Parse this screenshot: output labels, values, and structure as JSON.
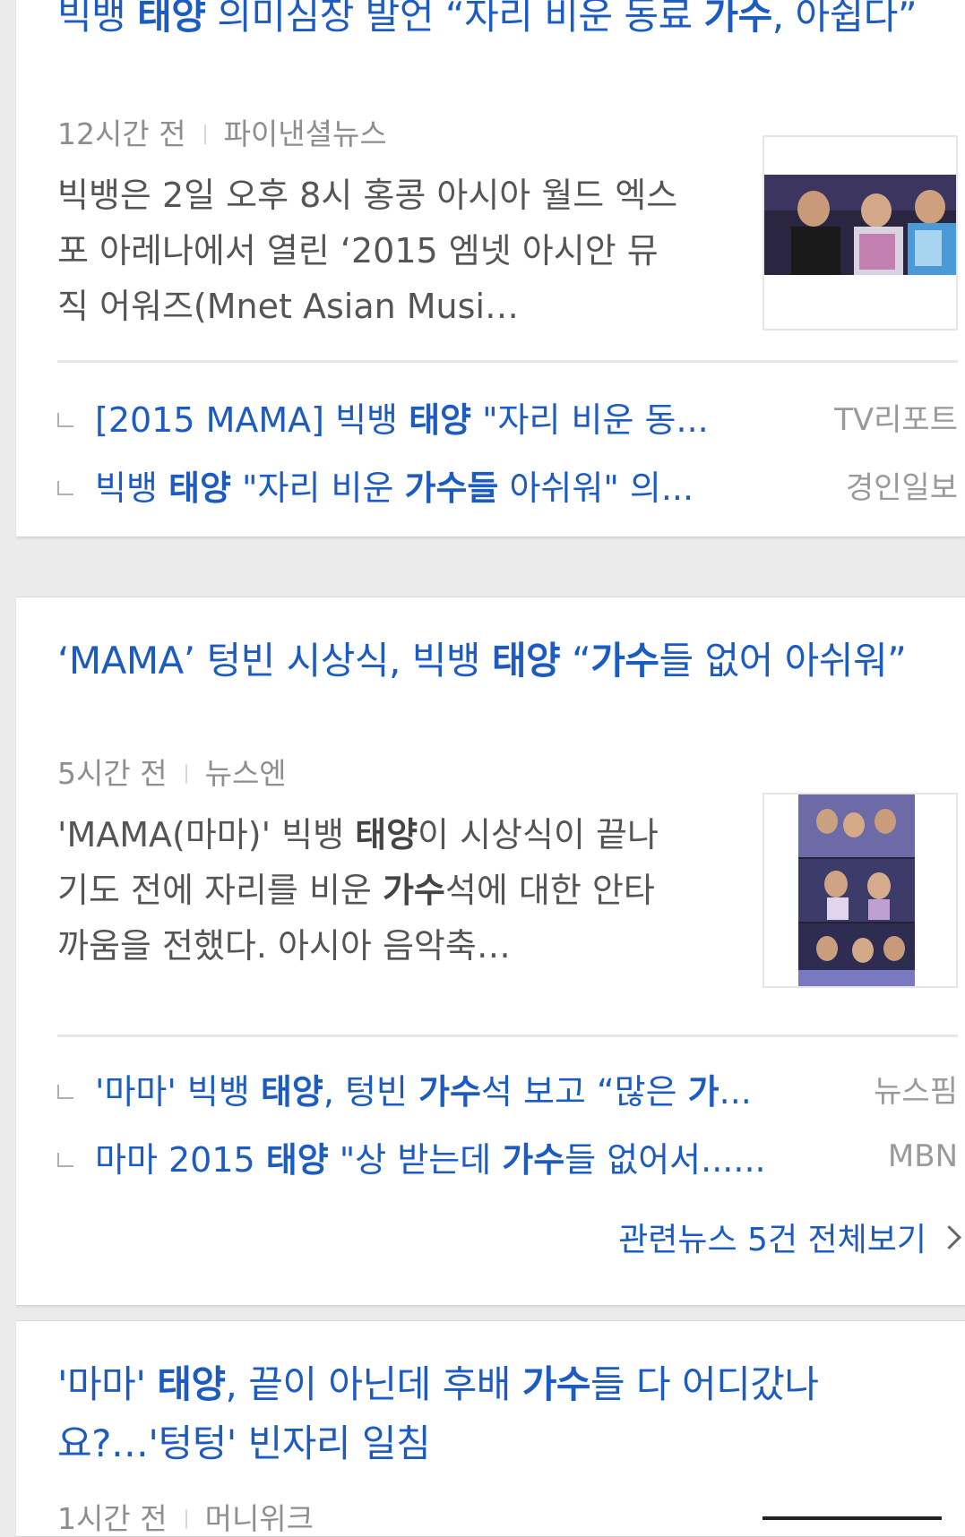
{
  "articles": [
    {
      "title_html": "빅뱅 <b>태양</b> 의미심장 발언 “자리 비운 동료 <b>가수</b>, 아쉽다”",
      "time": "12시간 전",
      "source": "파이낸셜뉴스",
      "summary_html": "빅뱅은 2일 오후 8시 홍콩 아시아 월드 엑스포 아레나에서 열린 ‘2015 엠넷 아시안 뮤직 어워즈(Mnet Asian Musi…",
      "related": [
        {
          "html": "[2015 MAMA] 빅뱅 <b>태양</b> \"자리 비운 동...",
          "source": "TV리포트"
        },
        {
          "html": "빅뱅 <b>태양</b> \"자리 비운 <b>가수들</b> 아쉬워\" 의...",
          "source": "경인일보"
        }
      ]
    },
    {
      "title_html": "‘MAMA’ 텅빈 시상식, 빅뱅 <b>태양</b> “<b>가수</b>들 없어 아쉬워”",
      "time": "5시간 전",
      "source": "뉴스엔",
      "summary_html": "'MAMA(마마)' 빅뱅 <b>태양</b>이 시상식이 끝나기도 전에 자리를 비운 <b>가수</b>석에 대한 안타까움을 전했다. 아시아 음악축…",
      "related": [
        {
          "html": "'마마' 빅뱅 <b>태양</b>, 텅빈 <b>가수</b>석 보고 “많은 <b>가</b>...",
          "source": "뉴스핌"
        },
        {
          "html": "마마 2015 <b>태양</b> \"상 받는데 <b>가수</b>들 없어서......",
          "source": "MBN"
        }
      ],
      "more_label": "관련뉴스 5건 전체보기"
    },
    {
      "title_html": "'마마' <b>태양</b>, 끝이 아닌데 후배 <b>가수</b>들 다 어디갔나요?…'텅텅' 빈자리 일침",
      "time": "1시간 전",
      "source": "머니위크"
    }
  ],
  "colors": {
    "link": "#1c5bc2",
    "meta": "#8e8e8e",
    "background": "#ebebeb"
  }
}
